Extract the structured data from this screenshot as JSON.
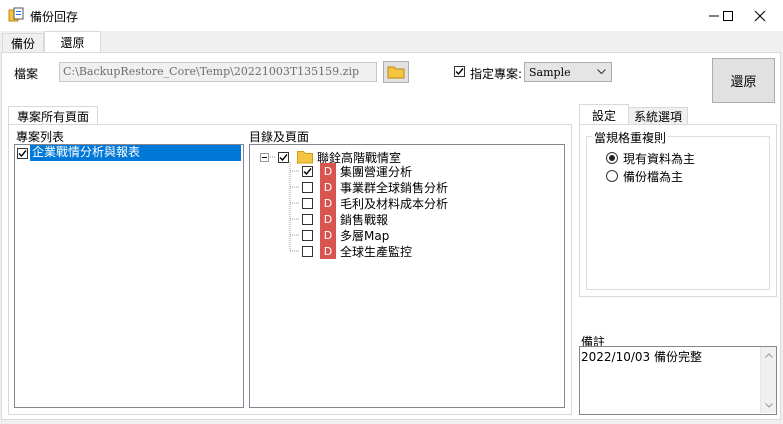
{
  "window": {
    "title": "備份回存"
  },
  "tabs": [
    {
      "label": "備份"
    },
    {
      "label": "還原"
    }
  ],
  "file": {
    "label": "檔案",
    "path": "C:\\BackupRestore_Core\\Temp\\20221003T135159.zip"
  },
  "specify_project": {
    "label": "指定專案:",
    "checked": true,
    "selected": "Sample"
  },
  "restore_button": {
    "label": "還原"
  },
  "project_pages": {
    "group_tab": "專案所有頁面",
    "project_list_label": "專案列表",
    "projects": [
      {
        "label": "企業戰情分析與報表",
        "checked": true,
        "selected": true
      }
    ],
    "tree_label": "目錄及頁面",
    "tree_root": {
      "label": "聯銓高階戰情室",
      "checked": true
    },
    "pages": [
      {
        "label": "集團營運分析",
        "checked": true,
        "icon": "D"
      },
      {
        "label": "事業群全球銷售分析",
        "checked": false,
        "icon": "D"
      },
      {
        "label": "毛利及材料成本分析",
        "checked": false,
        "icon": "D"
      },
      {
        "label": "銷售戰報",
        "checked": false,
        "icon": "D"
      },
      {
        "label": "多層Map",
        "checked": false,
        "icon": "D"
      },
      {
        "label": "全球生產監控",
        "checked": false,
        "icon": "D"
      }
    ]
  },
  "settings": {
    "tabs": [
      {
        "label": "設定"
      },
      {
        "label": "系統選項"
      }
    ],
    "group_label": "當規格重複則",
    "options": [
      {
        "label": "現有資料為主",
        "selected": true
      },
      {
        "label": "備份檔為主",
        "selected": false
      }
    ]
  },
  "notes": {
    "label": "備註",
    "text": "2022/10/03  備份完整"
  },
  "colors": {
    "selection": "#0078d7",
    "page_icon": "#d9534f",
    "folder": "#f5c542"
  }
}
